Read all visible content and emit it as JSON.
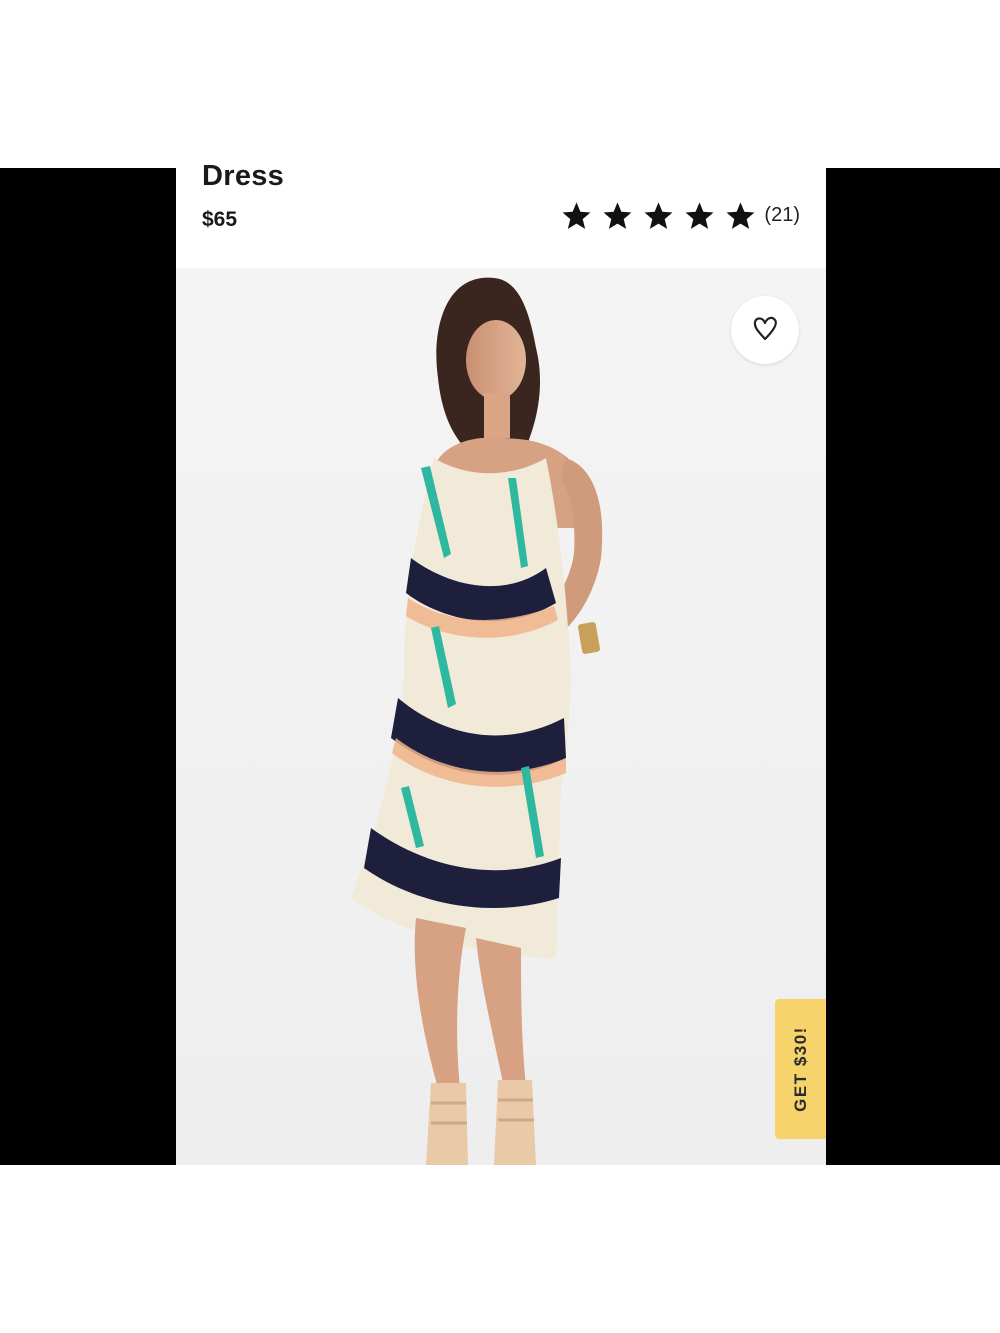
{
  "product": {
    "title": "Dress",
    "price": "$65"
  },
  "rating": {
    "stars": 5,
    "max_stars": 5,
    "count_label": "(21)"
  },
  "photo": {
    "subject": "model wearing printed halter dress"
  },
  "favorite": {
    "icon": "heart-icon"
  },
  "promo": {
    "label": "GET $30!",
    "color": "#f7d36b"
  }
}
